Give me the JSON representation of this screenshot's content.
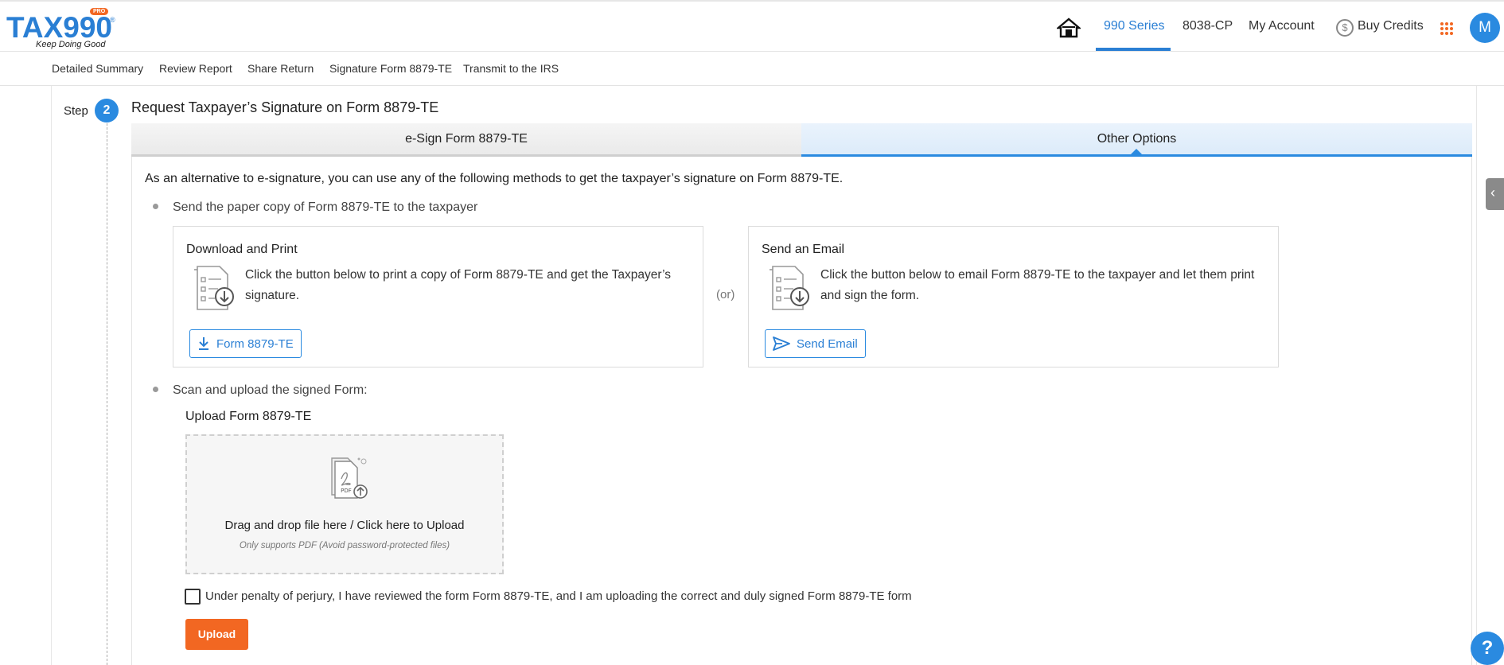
{
  "header": {
    "logo_text": "TAX990",
    "logo_tagline": "Keep Doing Good",
    "logo_badge": "PRO",
    "logo_reg": "®",
    "nav": {
      "series": "990 Series",
      "cp": "8038-CP",
      "account": "My Account",
      "credits": "Buy Credits"
    },
    "avatar_initial": "M",
    "accent_color": "#2a7fd4",
    "brand_orange": "#f26722"
  },
  "subnav": {
    "items": [
      "Detailed Summary",
      "Review Report",
      "Share Return",
      "Signature Form 8879-TE",
      "Transmit to the IRS"
    ]
  },
  "step": {
    "label": "Step",
    "number": "2",
    "title": "Request Taxpayer’s Signature on Form 8879-TE"
  },
  "tabs": {
    "esign": "e-Sign Form 8879-TE",
    "other": "Other Options",
    "active": "other"
  },
  "content": {
    "intro": "As an alternative to e-signature, you can use any of the following methods to get the taxpayer’s signature on Form 8879-TE.",
    "bullet1": "Send the paper copy of Form 8879-TE to the taxpayer",
    "download": {
      "title": "Download and Print",
      "desc": "Click the button below to print a copy of Form 8879-TE and get the Taxpayer’s signature.",
      "button": "Form 8879-TE"
    },
    "or": "(or)",
    "email": {
      "title": "Send an Email",
      "desc": "Click the button below to email Form 8879-TE to the taxpayer and let them print and sign the form.",
      "button": "Send Email"
    },
    "bullet2": "Scan and upload the signed Form:",
    "upload": {
      "title": "Upload Form 8879-TE",
      "pdf_label": "PDF",
      "drop_text": "Drag and drop file here / Click here to Upload",
      "drop_sub": "Only supports PDF (Avoid password-protected files)",
      "checkbox_label": "Under penalty of perjury, I have reviewed the form Form 8879-TE, and I am uploading the correct and duly signed Form 8879-TE form",
      "checkbox_checked": false,
      "button": "Upload"
    }
  },
  "misc": {
    "side_tab_icon": "chevron-left-icon",
    "side_tab_glyph": "‹",
    "help_glyph": "?"
  }
}
